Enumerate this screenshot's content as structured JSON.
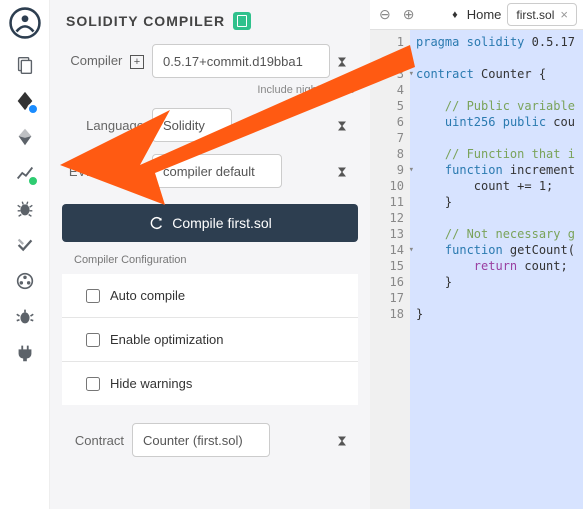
{
  "panel": {
    "title": "SOLIDITY COMPILER",
    "compiler_label": "Compiler",
    "compiler_value": "0.5.17+commit.d19bba1",
    "nightly_hint": "Include nightly build",
    "language_label": "Language",
    "language_value": "Solidity",
    "evm_label": "EVM Version",
    "evm_value": "compiler default",
    "compile_button": "Compile first.sol",
    "config_header": "Compiler Configuration",
    "opt_auto": "Auto compile",
    "opt_optimize": "Enable optimization",
    "opt_hide": "Hide warnings",
    "contract_label": "Contract",
    "contract_value": "Counter (first.sol)"
  },
  "tabs": {
    "home_label": "Home",
    "active_tab": "first.sol"
  },
  "code": {
    "lines": [
      "pragma solidity 0.5.17",
      "",
      "contract Counter {",
      "",
      "    // Public variable",
      "    uint256 public cou",
      "",
      "    // Function that i",
      "    function increment",
      "        count += 1;",
      "    }",
      "",
      "    // Not necessary g",
      "    function getCount(",
      "        return count;",
      "    }",
      "",
      "}"
    ]
  }
}
